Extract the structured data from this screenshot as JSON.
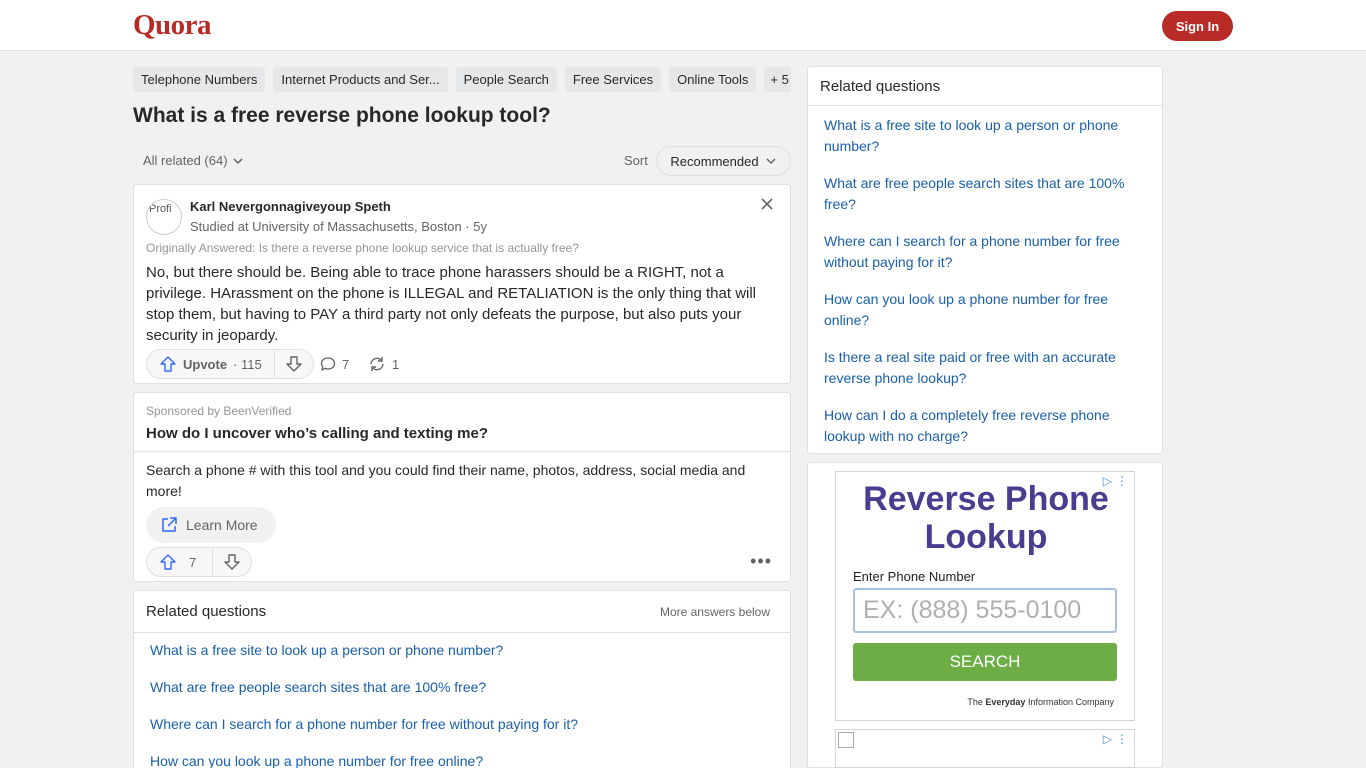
{
  "header": {
    "logo": "Quora",
    "signin_label": "Sign In"
  },
  "topics": [
    "Telephone Numbers",
    "Internet Products and Ser...",
    "People Search",
    "Free Services",
    "Online Tools",
    "+ 5"
  ],
  "question": {
    "title": "What is a free reverse phone lookup tool?",
    "all_related": "All related (64)",
    "sort_label": "Sort",
    "sort_value": "Recommended"
  },
  "answer": {
    "avatar_alt": "Profi",
    "author": "Karl Nevergonnagiveyoup Speth",
    "credential": "Studied at University of Massachusetts, Boston · 5y",
    "originally": "Originally Answered: Is there a reverse phone lookup service that is actually free?",
    "body": "No, but there should be. Being able to trace phone harassers should be a RIGHT, not a privilege. HArassment on the phone is ILLEGAL and RETALIATION is the only thing that will stop them, but having to PAY a third party not only defeats the purpose, but also puts your security in jeopardy.",
    "upvote_label": "Upvote",
    "upvote_count": "· 115",
    "comments": "7",
    "shares": "1"
  },
  "sponsored": {
    "label": "Sponsored by BeenVerified",
    "title": "How do I uncover who’s calling and texting me?",
    "body": "Search a phone # with this tool and you could find their name, photos, address, social media and more!",
    "cta": "Learn More",
    "upvotes": "7"
  },
  "related_main": {
    "title": "Related questions",
    "more": "More answers below",
    "items": [
      "What is a free site to look up a person or phone number?",
      "What are free people search sites that are 100% free?",
      "Where can I search for a phone number for free without paying for it?",
      "How can you look up a phone number for free online?"
    ]
  },
  "related_side": {
    "title": "Related questions",
    "items": [
      "What is a free site to look up a person or phone number?",
      "What are free people search sites that are 100% free?",
      "Where can I search for a phone number for free without paying for it?",
      "How can you look up a phone number for free online?",
      "Is there a real site paid or free with an accurate reverse phone lookup?",
      "How can I do a completely free reverse phone lookup with no charge?"
    ]
  },
  "ad": {
    "title": "Reverse Phone Lookup",
    "input_label": "Enter Phone Number",
    "input_placeholder": "EX: (888) 555-0100",
    "button": "SEARCH",
    "footer_pre": "The",
    "footer_brand": "Everyday",
    "footer_post": "Information Company"
  },
  "colors": {
    "brand": "#b92b27",
    "link": "#195faa",
    "ad_button": "#6dad46",
    "ad_title": "#4a3d8f"
  }
}
